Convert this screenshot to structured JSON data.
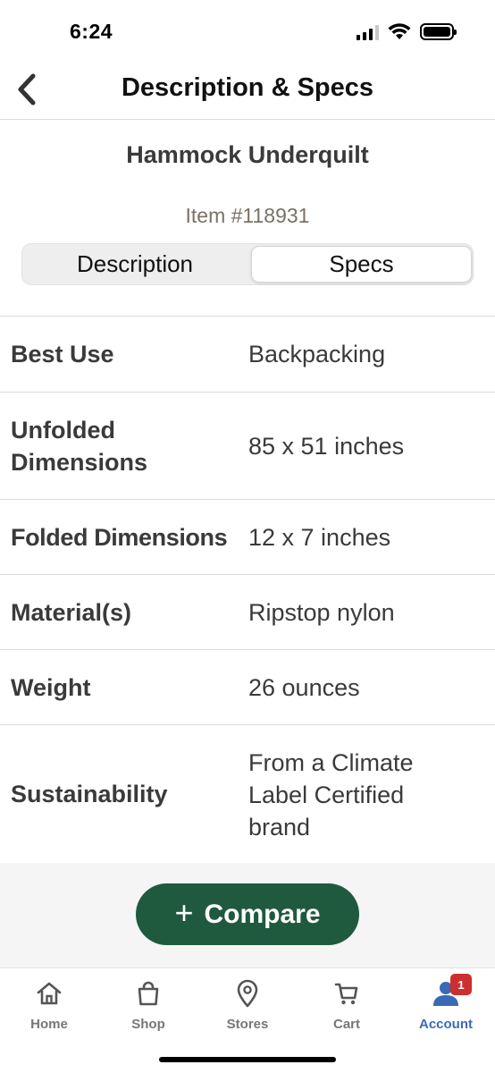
{
  "status_bar": {
    "time": "6:24"
  },
  "header": {
    "title": "Description & Specs",
    "back_icon": "chevron-left-icon"
  },
  "product": {
    "name": "Hammock Underquilt",
    "item_number": "Item #118931"
  },
  "segments": {
    "description_label": "Description",
    "specs_label": "Specs",
    "selected": "Specs"
  },
  "specs": [
    {
      "label": "Best Use",
      "value": "Backpacking"
    },
    {
      "label": "Unfolded Dimensions",
      "value": "85 x 51 inches"
    },
    {
      "label": "Folded Dimensions",
      "value": "12 x 7 inches"
    },
    {
      "label": "Material(s)",
      "value": "Ripstop nylon"
    },
    {
      "label": "Weight",
      "value": "26 ounces"
    },
    {
      "label": "Sustainability",
      "value": "From a Climate Label Certified brand"
    }
  ],
  "compare": {
    "plus": "+",
    "label": "Compare"
  },
  "tab_bar": {
    "home": "Home",
    "shop": "Shop",
    "stores": "Stores",
    "cart": "Cart",
    "account": "Account",
    "account_badge": "1",
    "active_tab": "Account",
    "active_color": "#3a6ab5"
  },
  "colors": {
    "compare_button": "#1f5a3f",
    "badge": "#cc2f2f"
  }
}
